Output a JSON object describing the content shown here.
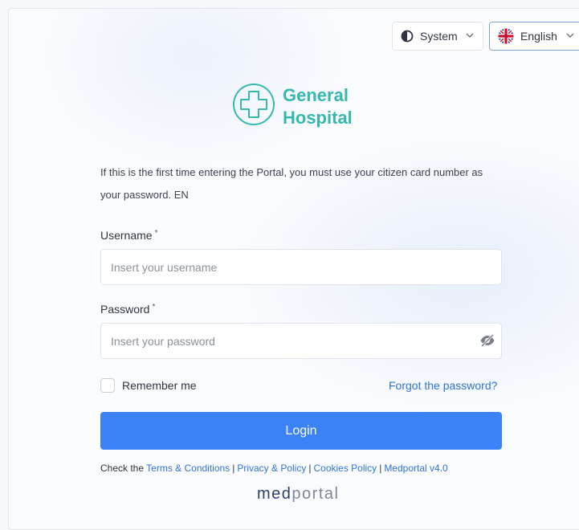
{
  "colors": {
    "accent": "#3b82f6",
    "brand_teal": "#36b7b0",
    "link": "#2f73d4"
  },
  "header": {
    "theme_selector": {
      "label": "System",
      "icon": "half-circle-contrast-icon"
    },
    "language_selector": {
      "label": "English",
      "icon": "uk-flag-icon"
    }
  },
  "logo": {
    "icon": "hospital-cross-icon",
    "line1": "General",
    "line2": "Hospital"
  },
  "info_text": "If this is the first time entering the Portal, you must use your citizen card number as your password. EN",
  "form": {
    "username": {
      "label": "Username",
      "required_mark": "*",
      "placeholder": "Insert your username",
      "value": ""
    },
    "password": {
      "label": "Password",
      "required_mark": "*",
      "placeholder": "Insert your password",
      "value": ""
    },
    "remember_label": "Remember me",
    "forgot_label": "Forgot the password?",
    "login_label": "Login"
  },
  "footer": {
    "prefix": "Check the",
    "links": [
      "Terms & Conditions",
      "Privacy & Policy",
      "Cookies Policy",
      "Medportal v4.0"
    ],
    "separator": "|"
  },
  "brand": {
    "part1": "med",
    "part2": "portal"
  }
}
